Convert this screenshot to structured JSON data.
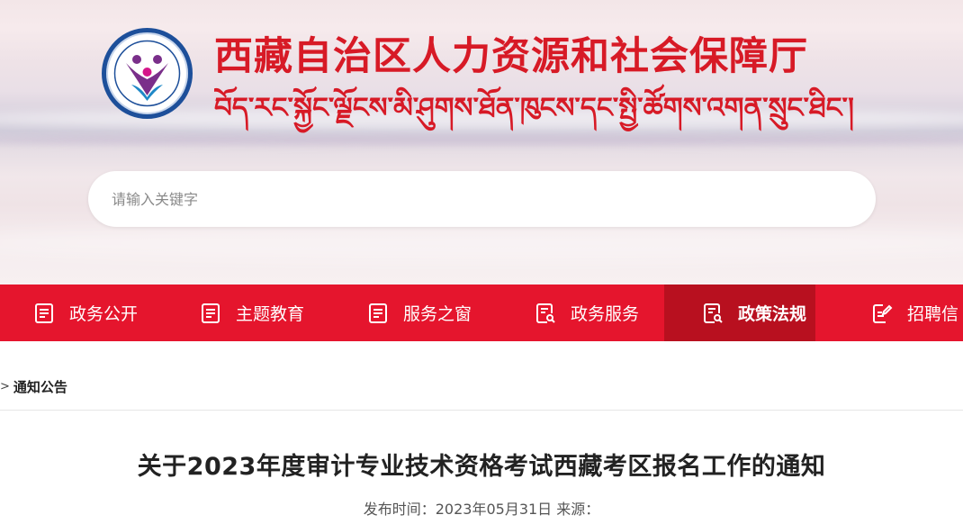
{
  "header": {
    "title_cn": "西藏自治区人力资源和社会保障厅",
    "title_tibetan": "བོད་རང་སྐྱོང་ལྗོངས་མི་ཤུགས་ཐོན་ཁུངས་དང་སྤྱི་ཚོགས་འགན་སྲུང་ཐིང་།",
    "colors": {
      "brand_red": "#d71a26",
      "nav_red": "#e5152d",
      "nav_active": "#b8101f",
      "logo_blue": "#1d4f9a"
    }
  },
  "search": {
    "placeholder": "请输入关键字",
    "value": "",
    "icon": "search-icon"
  },
  "nav": {
    "items": [
      {
        "label": "政务公开",
        "icon": "document-icon",
        "active": false
      },
      {
        "label": "主题教育",
        "icon": "document-icon",
        "active": false
      },
      {
        "label": "服务之窗",
        "icon": "document-icon",
        "active": false
      },
      {
        "label": "政务服务",
        "icon": "document-search-icon",
        "active": false
      },
      {
        "label": "政策法规",
        "icon": "document-search-icon",
        "active": true
      },
      {
        "label": "招聘信",
        "icon": "edit-document-icon",
        "active": false
      }
    ]
  },
  "breadcrumb": {
    "arrow": ">",
    "current": "通知公告"
  },
  "article": {
    "title": "关于2023年度审计专业技术资格考试西藏考区报名工作的通知",
    "meta": "发布时间：2023年05月31日 来源："
  }
}
